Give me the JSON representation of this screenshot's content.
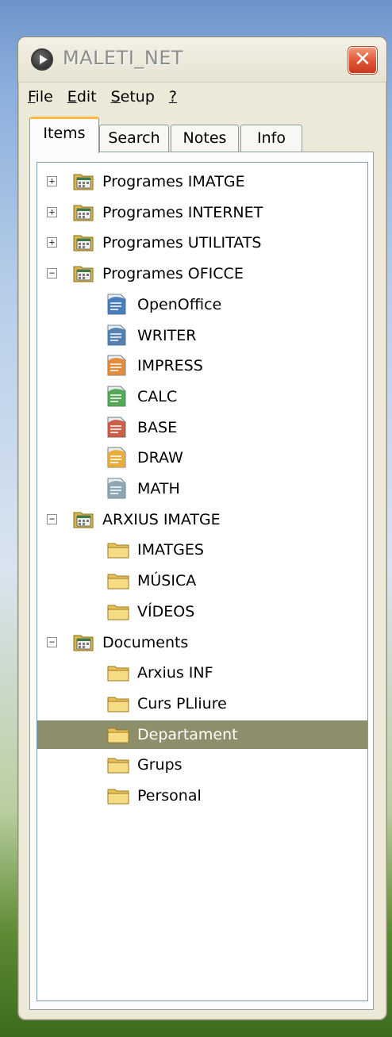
{
  "window": {
    "title": "MALETI_NET",
    "close_label": "✕"
  },
  "menu": [
    {
      "name": "menu-file",
      "label": "File",
      "accel": "F",
      "rest": "ile"
    },
    {
      "name": "menu-edit",
      "label": "Edit",
      "accel": "E",
      "rest": "dit"
    },
    {
      "name": "menu-setup",
      "label": "Setup",
      "accel": "S",
      "rest": "etup"
    },
    {
      "name": "menu-help",
      "label": "?",
      "accel": "?",
      "rest": ""
    }
  ],
  "tabs": [
    {
      "label": "Items",
      "active": true
    },
    {
      "label": "Search",
      "active": false
    },
    {
      "label": "Notes",
      "active": false
    },
    {
      "label": "Info",
      "active": false
    }
  ],
  "tree": [
    {
      "label": "Programes IMATGE",
      "kind": "group",
      "expander": "+"
    },
    {
      "label": "Programes INTERNET",
      "kind": "group",
      "expander": "+"
    },
    {
      "label": "Programes UTILITATS",
      "kind": "group",
      "expander": "+"
    },
    {
      "label": "Programes OFICCE",
      "kind": "group",
      "expander": "−"
    },
    {
      "label": "OpenOffice",
      "kind": "app",
      "icon": "openoffice-icon",
      "color": "#2e6ab1"
    },
    {
      "label": "WRITER",
      "kind": "app",
      "icon": "writer-icon",
      "color": "#3b6fa6"
    },
    {
      "label": "IMPRESS",
      "kind": "app",
      "icon": "impress-icon",
      "color": "#e07a1f"
    },
    {
      "label": "CALC",
      "kind": "app",
      "icon": "calc-icon",
      "color": "#3d9a3d"
    },
    {
      "label": "BASE",
      "kind": "app",
      "icon": "base-icon",
      "color": "#c4452d"
    },
    {
      "label": "DRAW",
      "kind": "app",
      "icon": "draw-icon",
      "color": "#e6a21e"
    },
    {
      "label": "MATH",
      "kind": "app",
      "icon": "math-icon",
      "color": "#7f9aa8"
    },
    {
      "label": "ARXIUS IMATGE",
      "kind": "group",
      "expander": "−"
    },
    {
      "label": "IMATGES",
      "kind": "folder"
    },
    {
      "label": "MÚSICA",
      "kind": "folder"
    },
    {
      "label": "VÍDEOS",
      "kind": "folder"
    },
    {
      "label": "Documents",
      "kind": "group",
      "expander": "−"
    },
    {
      "label": "Arxius INF",
      "kind": "folder"
    },
    {
      "label": "Curs PLliure",
      "kind": "folder"
    },
    {
      "label": "Departament",
      "kind": "folder",
      "selected": true
    },
    {
      "label": "Grups",
      "kind": "folder"
    },
    {
      "label": "Personal",
      "kind": "folder"
    }
  ]
}
